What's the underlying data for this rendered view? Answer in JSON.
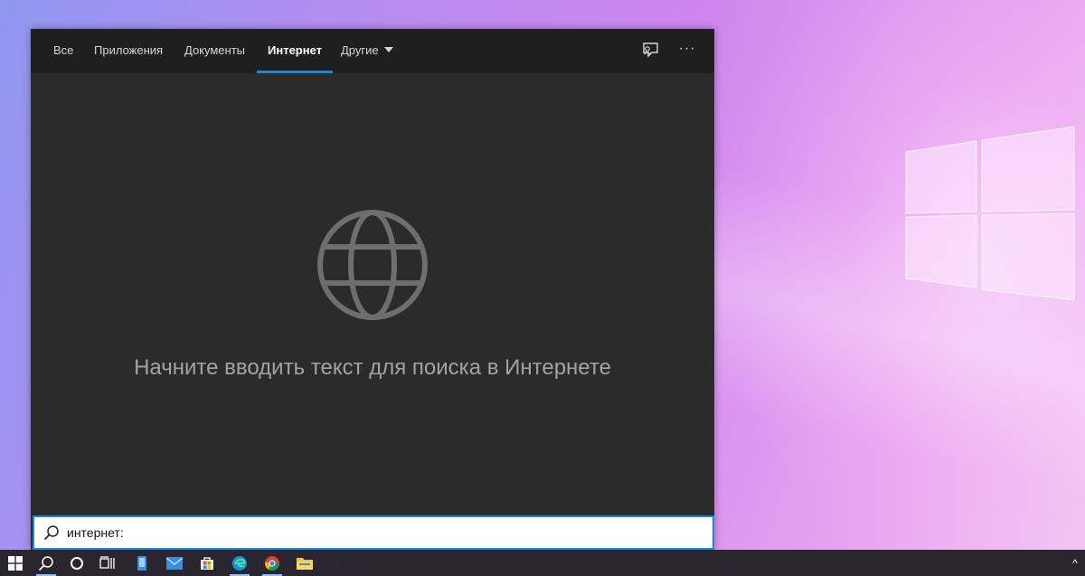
{
  "tabs": [
    {
      "label": "Все"
    },
    {
      "label": "Приложения"
    },
    {
      "label": "Документы"
    },
    {
      "label": "Интернет"
    },
    {
      "label": "Другие"
    }
  ],
  "active_tab": "Интернет",
  "main": {
    "hint": "Начните вводить текст для поиска в Интернете",
    "icon": "globe-icon"
  },
  "toolbar": {
    "feedback_icon": "feedback-icon",
    "more_label": "···"
  },
  "search": {
    "value": "интернет:"
  },
  "colors": {
    "accent": "#1f86d6",
    "panel_bg": "#2b2b2b",
    "topbar_bg": "#1f1f1f"
  },
  "taskbar": {
    "items": [
      "windows-start-icon",
      "search-icon",
      "cortana-icon",
      "task-view-icon",
      "phone-icon",
      "mail-icon",
      "store-icon",
      "edge-icon",
      "chrome-icon",
      "file-explorer-icon",
      "app-icon"
    ],
    "tray_chevron": "^"
  }
}
